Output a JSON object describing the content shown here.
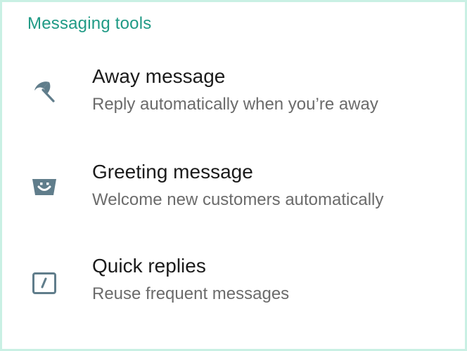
{
  "section": {
    "title": "Messaging tools"
  },
  "items": [
    {
      "icon": "umbrella-icon",
      "title": "Away message",
      "subtitle": "Reply automatically when you’re away"
    },
    {
      "icon": "greeting-icon",
      "title": "Greeting message",
      "subtitle": "Welcome new customers automatically"
    },
    {
      "icon": "quick-reply-icon",
      "title": "Quick replies",
      "subtitle": "Reuse frequent messages"
    }
  ],
  "colors": {
    "accent": "#1f9a85",
    "icon": "#607d8b",
    "title": "#1b1b1b",
    "subtitle": "#6b6b6b",
    "frame_border": "#c9f0e4"
  }
}
